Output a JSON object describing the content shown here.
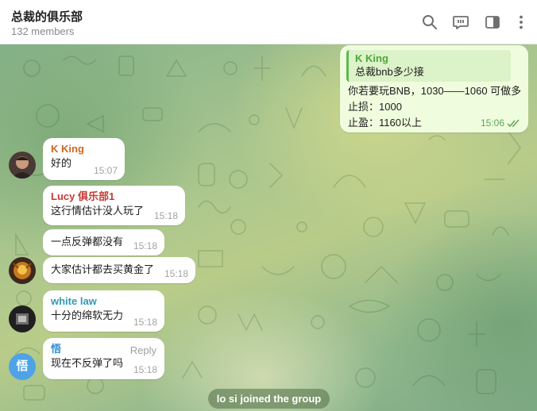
{
  "header": {
    "title": "总裁的俱乐部",
    "members": "132 members",
    "icons": [
      "search-icon",
      "comments-icon",
      "sidebar-toggle-icon",
      "more-vertical-icon"
    ]
  },
  "colors": {
    "header_bg": "#ffffff",
    "incoming_bubble": "#ffffff",
    "outgoing_bubble": "#effdde",
    "name_king": "#d0661f",
    "name_lucy": "#c63a32",
    "name_white_law": "#2d9ab8",
    "name_wu": "#2f8ed6",
    "reply_accent": "#5fb850"
  },
  "outgoing": {
    "reply_to_name": "K King",
    "reply_to_text": "总裁bnb多少接",
    "lines": [
      "你若要玩BNB，1030——1060 可做多",
      "止损：1000",
      "止盈：1160以上"
    ],
    "time": "15:06"
  },
  "messages": [
    {
      "sender": "K King",
      "text": "好的",
      "time": "15:07",
      "avatar": "k-king-avatar"
    },
    {
      "sender": "Lucy 俱乐部1",
      "text": "这行情估计没人玩了",
      "time": "15:18"
    },
    {
      "text": "一点反弹都没有",
      "time": "15:18"
    },
    {
      "text": "大家估计都去买黄金了",
      "time": "15:18",
      "avatar": "lucy-avatar"
    },
    {
      "sender": "white law",
      "text": "十分的绵软无力",
      "time": "15:18",
      "avatar": "white-law-avatar"
    },
    {
      "sender": "悟",
      "text": "现在不反弹了吗",
      "time": "15:18",
      "reply_label": "Reply",
      "avatar_letter": "悟"
    }
  ],
  "service_message": "lo si joined the group"
}
